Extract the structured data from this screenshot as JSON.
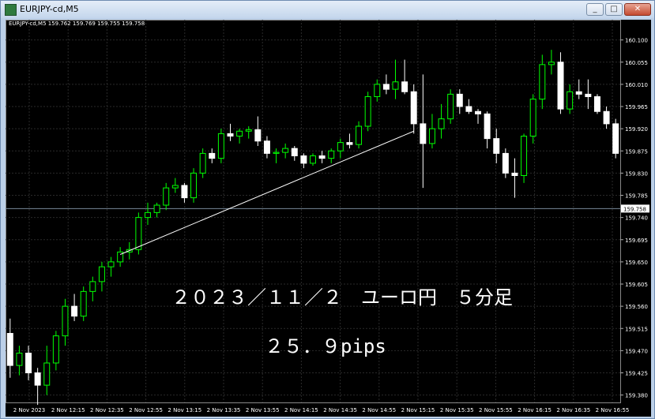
{
  "window": {
    "title": "EURJPY-cd,M5",
    "minimize": "_",
    "maximize": "□",
    "close": "✕"
  },
  "chart_header": "EURJPY-cd,M5  159.762 159.769 159.755 159.758",
  "annotations": {
    "line1": "２０２３／１１／２　ユーロ円　５分足",
    "line2": "２５．９pips"
  },
  "colors": {
    "background": "#000000",
    "bull": "#00ff00",
    "bear": "#ffffff",
    "grid": "#2a2a2a",
    "current_price_line": "#778899"
  },
  "chart_data": {
    "type": "candlestick",
    "symbol": "EURJPY-cd",
    "timeframe": "M5",
    "y_ticks": [
      160.1,
      160.055,
      160.01,
      159.965,
      159.92,
      159.875,
      159.83,
      159.785,
      159.74,
      159.695,
      159.65,
      159.605,
      159.56,
      159.515,
      159.47,
      159.425,
      159.38
    ],
    "ylim": [
      159.365,
      160.125
    ],
    "current_price": 159.758,
    "x_ticks": [
      "2 Nov 2023",
      "2 Nov 12:15",
      "2 Nov 12:35",
      "2 Nov 12:55",
      "2 Nov 13:15",
      "2 Nov 13:35",
      "2 Nov 13:55",
      "2 Nov 14:15",
      "2 Nov 14:35",
      "2 Nov 14:55",
      "2 Nov 15:15",
      "2 Nov 15:35",
      "2 Nov 15:55",
      "2 Nov 16:15",
      "2 Nov 16:35",
      "2 Nov 16:55"
    ],
    "candles": [
      [
        159.505,
        159.535,
        159.415,
        159.44
      ],
      [
        159.44,
        159.48,
        159.42,
        159.465
      ],
      [
        159.465,
        159.48,
        159.41,
        159.425
      ],
      [
        159.425,
        159.435,
        159.36,
        159.4
      ],
      [
        159.4,
        159.48,
        159.38,
        159.445
      ],
      [
        159.445,
        159.51,
        159.43,
        159.5
      ],
      [
        159.5,
        159.575,
        159.48,
        159.56
      ],
      [
        159.56,
        159.585,
        159.53,
        159.54
      ],
      [
        159.54,
        159.6,
        159.53,
        159.59
      ],
      [
        159.59,
        159.62,
        159.57,
        159.61
      ],
      [
        159.61,
        159.65,
        159.59,
        159.64
      ],
      [
        159.64,
        159.66,
        159.62,
        159.65
      ],
      [
        159.65,
        159.68,
        159.64,
        159.67
      ],
      [
        159.67,
        159.69,
        159.655,
        159.675
      ],
      [
        159.675,
        159.75,
        159.665,
        159.74
      ],
      [
        159.74,
        159.77,
        159.725,
        159.75
      ],
      [
        159.75,
        159.77,
        159.74,
        159.765
      ],
      [
        159.765,
        159.81,
        159.755,
        159.8
      ],
      [
        159.8,
        159.82,
        159.79,
        159.805
      ],
      [
        159.805,
        159.81,
        159.77,
        159.78
      ],
      [
        159.78,
        159.84,
        159.77,
        159.83
      ],
      [
        159.83,
        159.88,
        159.82,
        159.87
      ],
      [
        159.87,
        159.88,
        159.85,
        159.86
      ],
      [
        159.86,
        159.92,
        159.85,
        159.91
      ],
      [
        159.91,
        159.93,
        159.895,
        159.905
      ],
      [
        159.905,
        159.92,
        159.89,
        159.915
      ],
      [
        159.915,
        159.925,
        159.9,
        159.918
      ],
      [
        159.918,
        159.945,
        159.885,
        159.895
      ],
      [
        159.895,
        159.905,
        159.86,
        159.87
      ],
      [
        159.87,
        159.88,
        159.85,
        159.872
      ],
      [
        159.872,
        159.89,
        159.86,
        159.88
      ],
      [
        159.88,
        159.885,
        159.855,
        159.865
      ],
      [
        159.865,
        159.87,
        159.84,
        159.85
      ],
      [
        159.85,
        159.87,
        159.845,
        159.865
      ],
      [
        159.865,
        159.875,
        159.85,
        159.86
      ],
      [
        159.86,
        159.88,
        159.85,
        159.875
      ],
      [
        159.875,
        159.9,
        159.86,
        159.892
      ],
      [
        159.892,
        159.91,
        159.88,
        159.888
      ],
      [
        159.888,
        159.935,
        159.88,
        159.925
      ],
      [
        159.925,
        159.995,
        159.915,
        159.985
      ],
      [
        159.985,
        160.02,
        159.975,
        160.01
      ],
      [
        160.01,
        160.03,
        159.99,
        160.0
      ],
      [
        160.0,
        160.06,
        159.98,
        160.015
      ],
      [
        160.015,
        160.06,
        159.99,
        159.995
      ],
      [
        159.995,
        160.01,
        159.91,
        159.93
      ],
      [
        159.93,
        160.03,
        159.8,
        159.89
      ],
      [
        159.89,
        159.95,
        159.88,
        159.92
      ],
      [
        159.92,
        159.97,
        159.9,
        159.94
      ],
      [
        159.94,
        160.0,
        159.93,
        159.99
      ],
      [
        159.99,
        160.0,
        159.95,
        159.965
      ],
      [
        159.965,
        159.98,
        159.95,
        159.955
      ],
      [
        159.955,
        159.96,
        159.93,
        159.95
      ],
      [
        159.95,
        159.955,
        159.88,
        159.9
      ],
      [
        159.9,
        159.92,
        159.85,
        159.87
      ],
      [
        159.87,
        159.88,
        159.82,
        159.83
      ],
      [
        159.83,
        159.86,
        159.78,
        159.825
      ],
      [
        159.825,
        159.91,
        159.81,
        159.905
      ],
      [
        159.905,
        159.99,
        159.89,
        159.98
      ],
      [
        159.98,
        160.07,
        159.96,
        160.05
      ],
      [
        160.05,
        160.08,
        160.03,
        160.055
      ],
      [
        160.055,
        160.075,
        159.95,
        159.96
      ],
      [
        159.96,
        160.01,
        159.95,
        159.995
      ],
      [
        159.995,
        160.02,
        159.98,
        159.99
      ],
      [
        159.99,
        160.02,
        159.96,
        159.985
      ],
      [
        159.985,
        159.99,
        159.95,
        159.955
      ],
      [
        159.955,
        159.965,
        159.92,
        159.93
      ],
      [
        159.93,
        159.94,
        159.86,
        159.87
      ]
    ],
    "trendline": {
      "from_index": 12,
      "from_price": 159.665,
      "to_index": 44,
      "to_price": 159.915
    }
  }
}
